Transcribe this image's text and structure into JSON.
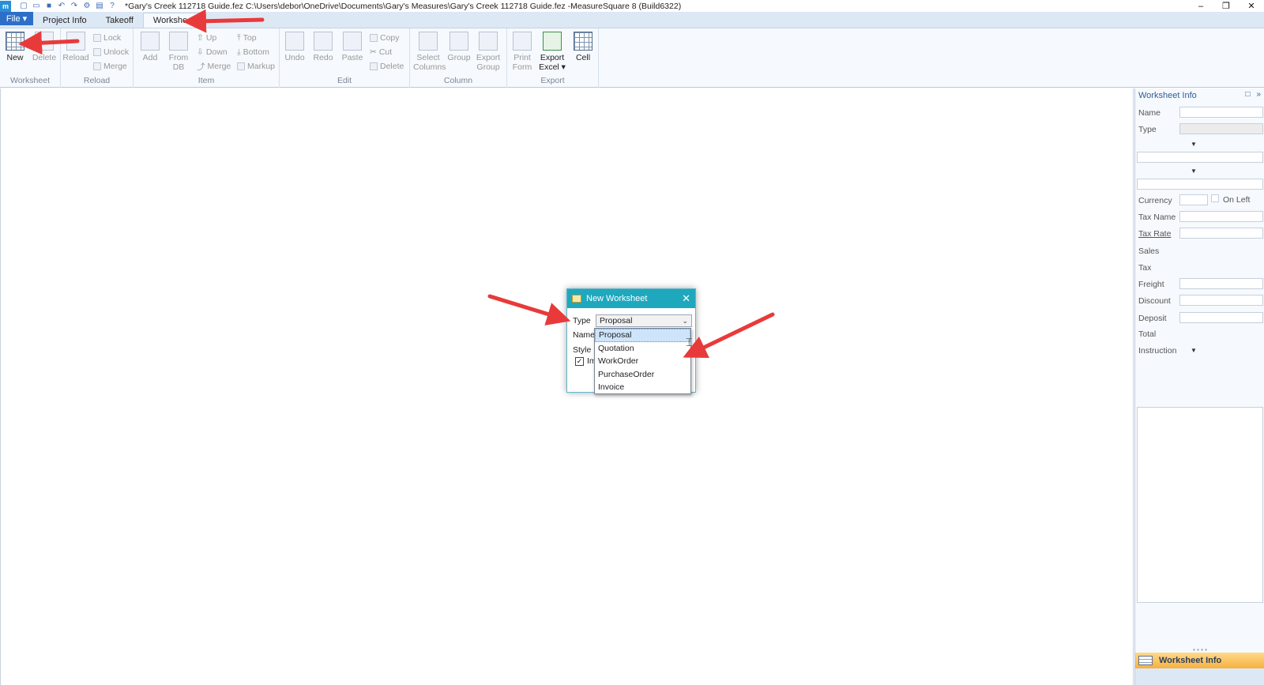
{
  "app": {
    "title": "*Gary's Creek 112718 Guide.fez C:\\Users\\debor\\OneDrive\\Documents\\Gary's Measures\\Gary's Creek 112718 Guide.fez -MeasureSquare 8 (Build6322)",
    "icon_letter": "m",
    "window_controls": [
      "–",
      "❐",
      "✕"
    ]
  },
  "menu": {
    "file": "File ▾",
    "tabs": [
      "Project Info",
      "Takeoff",
      "Worksheet"
    ],
    "active_tab": "Worksheet"
  },
  "ribbon": {
    "worksheet_group": {
      "label": "Worksheet",
      "new": "New",
      "delete": "Delete"
    },
    "reload_group": {
      "label": "Reload",
      "reload": "Reload",
      "lock": "Lock",
      "unlock": "Unlock",
      "merge": "Merge"
    },
    "item_group": {
      "label": "Item",
      "add": "Add",
      "from_db_1": "From",
      "from_db_2": "DB",
      "up": "Up",
      "down": "Down",
      "merge": "Merge",
      "top": "Top",
      "bottom": "Bottom",
      "markup": "Markup"
    },
    "edit_group": {
      "label": "Edit",
      "undo": "Undo",
      "redo": "Redo",
      "paste": "Paste",
      "copy": "Copy",
      "cut": "Cut",
      "delete": "Delete"
    },
    "column_group": {
      "label": "Column",
      "select_columns_1": "Select",
      "select_columns_2": "Columns",
      "group": "Group",
      "export_group_1": "Export",
      "export_group_2": "Group"
    },
    "export_group": {
      "label": "Export",
      "print_form_1": "Print",
      "print_form_2": "Form",
      "export_excel_1": "Export",
      "export_excel_2": "Excel ▾",
      "cell": "Cell"
    }
  },
  "right_panel": {
    "title": "Worksheet Info",
    "labels": {
      "name": "Name",
      "type": "Type",
      "currency": "Currency",
      "on_left": "On Left",
      "tax_name": "Tax Name",
      "tax_rate": "Tax Rate",
      "sales": "Sales",
      "tax": "Tax",
      "freight": "Freight",
      "discount": "Discount",
      "deposit": "Deposit",
      "total": "Total",
      "instruction": "Instruction"
    },
    "footer_title": "Worksheet Info"
  },
  "dialog": {
    "title": "New Worksheet",
    "type_label": "Type",
    "name_label": "Name",
    "style_label": "Style",
    "type_value": "Proposal",
    "checkbox_label": "Im",
    "options": [
      "Proposal",
      "Quotation",
      "WorkOrder",
      "PurchaseOrder",
      "Invoice"
    ],
    "selected_option": "Proposal"
  },
  "colors": {
    "arrow": "#e83a3a",
    "file_tab": "#2d6fc8",
    "dialog_title": "#1fa8bd",
    "footer_bar": "#f6b13f"
  }
}
